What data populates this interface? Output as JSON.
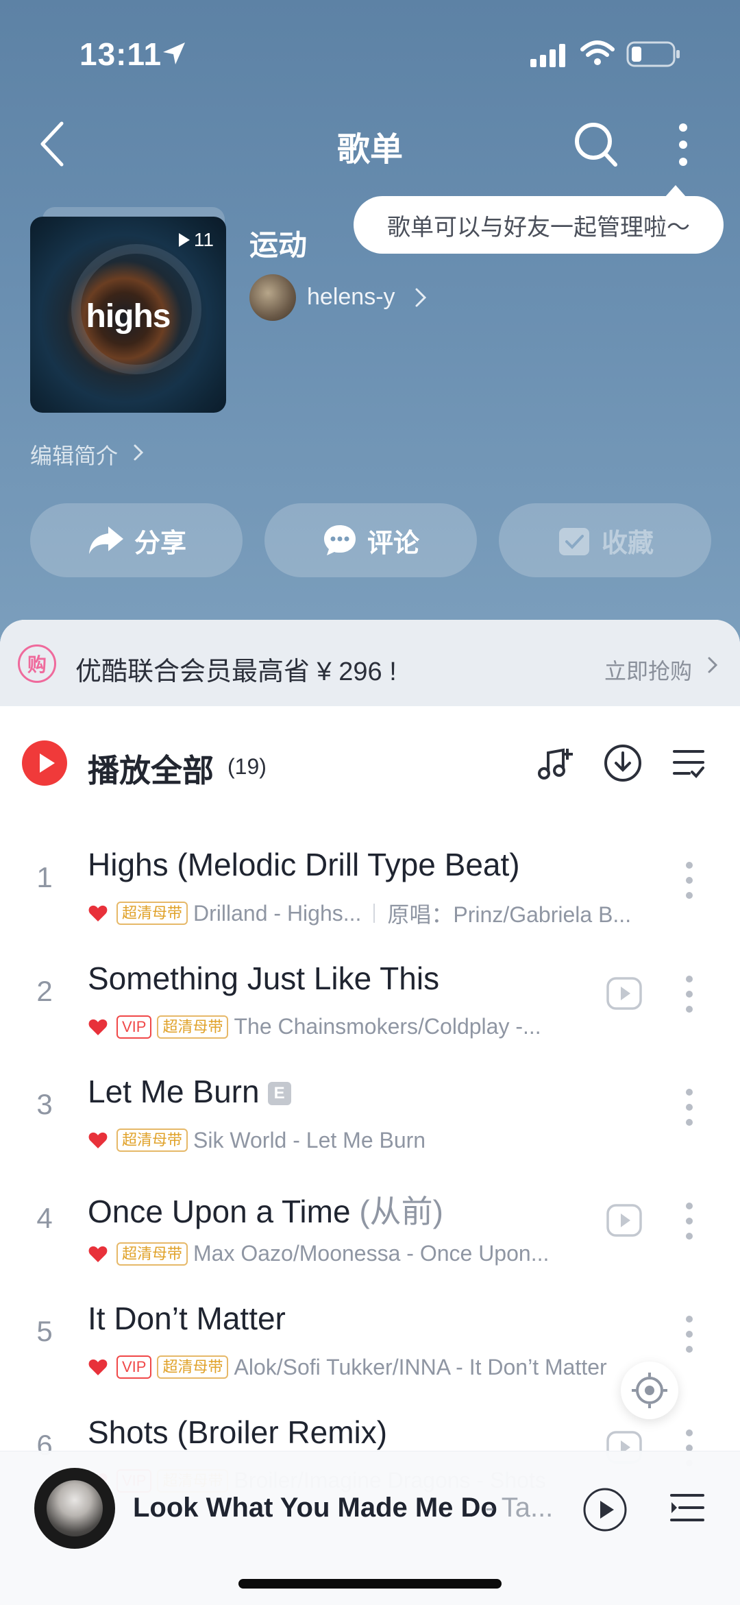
{
  "status_bar": {
    "time": "13:11"
  },
  "nav": {
    "title": "歌单"
  },
  "tooltip": {
    "text": "歌单可以与好友一起管理啦～"
  },
  "playlist": {
    "cover_text": "highs",
    "play_count": "11",
    "name": "运动",
    "creator": "helens-y",
    "edit_intro": "编辑简介"
  },
  "actions": {
    "share": "分享",
    "comment": "评论",
    "collect": "收藏"
  },
  "promo": {
    "icon_text": "购",
    "text": "优酷联合会员最高省 ¥ 296 !",
    "action": "立即抢购"
  },
  "play_all": {
    "label": "播放全部",
    "count": "(19)"
  },
  "songs": [
    {
      "index": "1",
      "title": "Highs (Melodic Drill Type Beat)",
      "subtitle": "",
      "explicit": false,
      "vip": false,
      "hq": "超清母带",
      "meta": "Drilland - Highs...",
      "original": "原唱：Prinz/Gabriela B...",
      "mv": false
    },
    {
      "index": "2",
      "title": "Something Just Like This",
      "subtitle": "",
      "explicit": false,
      "vip": true,
      "vip_label": "VIP",
      "hq": "超清母带",
      "meta": "The Chainsmokers/Coldplay -...",
      "original": "",
      "mv": true
    },
    {
      "index": "3",
      "title": "Let Me Burn",
      "subtitle": "",
      "explicit": true,
      "explicit_label": "E",
      "vip": false,
      "hq": "超清母带",
      "meta": "Sik World - Let Me Burn",
      "original": "",
      "mv": false
    },
    {
      "index": "4",
      "title": "Once Upon a Time",
      "subtitle": "(从前)",
      "explicit": false,
      "vip": false,
      "hq": "超清母带",
      "meta": "Max Oazo/Moonessa - Once Upon...",
      "original": "",
      "mv": true
    },
    {
      "index": "5",
      "title": "It Don’t Matter",
      "subtitle": "",
      "explicit": false,
      "vip": true,
      "vip_label": "VIP",
      "hq": "超清母带",
      "meta": "Alok/Sofi Tukker/INNA - It Don’t Matter",
      "original": "",
      "mv": false
    },
    {
      "index": "6",
      "title": "Shots (Broiler Remix)",
      "subtitle": "",
      "explicit": false,
      "vip": true,
      "vip_label": "VIP",
      "hq": "超清母带",
      "meta": "Broiler/Imagine Dragons - Shots",
      "original": "",
      "mv": true
    }
  ],
  "mini_player": {
    "title": "Look What You Made Me Do",
    "artist": "- Ta..."
  },
  "colors": {
    "accent_red": "#f03a3a",
    "vip_red": "#f04848",
    "hq_gold": "#e0a22a",
    "hero_blue": "#6a8fb1"
  }
}
